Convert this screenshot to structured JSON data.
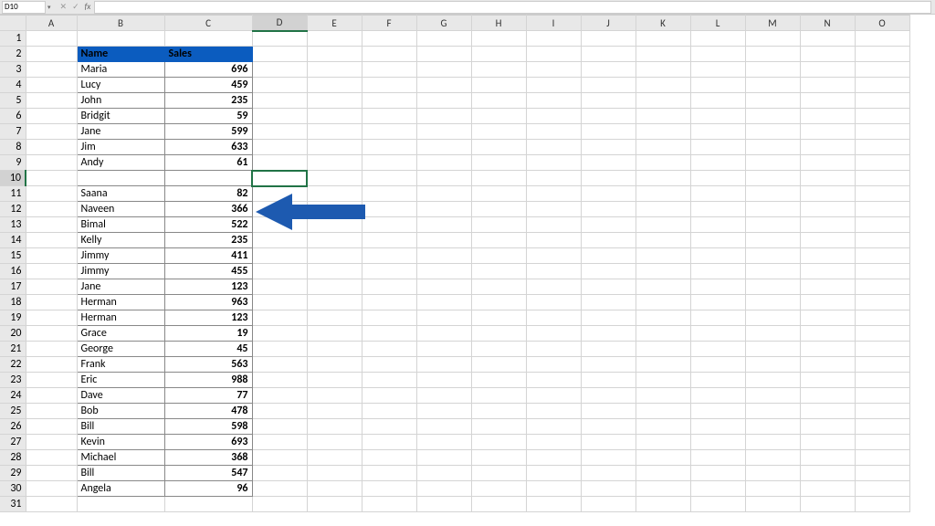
{
  "namebox": "D10",
  "fx": {
    "cancel": "✕",
    "accept": "✓",
    "fx": "fx"
  },
  "columns": [
    "A",
    "B",
    "C",
    "D",
    "E",
    "F",
    "G",
    "H",
    "I",
    "J",
    "K",
    "L",
    "M",
    "N",
    "O"
  ],
  "selectedCol": "D",
  "selectedRow": 10,
  "headerRow": 2,
  "tableHeaders": {
    "name": "Name",
    "sales": "Sales"
  },
  "rows": [
    {
      "r": 3,
      "name": "Maria",
      "sales": 696
    },
    {
      "r": 4,
      "name": "Lucy",
      "sales": 459
    },
    {
      "r": 5,
      "name": "John",
      "sales": 235
    },
    {
      "r": 6,
      "name": "Bridgit",
      "sales": 59
    },
    {
      "r": 7,
      "name": "Jane",
      "sales": 599
    },
    {
      "r": 8,
      "name": "Jim",
      "sales": 633
    },
    {
      "r": 9,
      "name": "Andy",
      "sales": 61
    },
    {
      "r": 10,
      "name": "",
      "sales": ""
    },
    {
      "r": 11,
      "name": "Saana",
      "sales": 82
    },
    {
      "r": 12,
      "name": "Naveen",
      "sales": 366
    },
    {
      "r": 13,
      "name": "Bimal",
      "sales": 522
    },
    {
      "r": 14,
      "name": "Kelly",
      "sales": 235
    },
    {
      "r": 15,
      "name": "Jimmy",
      "sales": 411
    },
    {
      "r": 16,
      "name": "Jimmy",
      "sales": 455
    },
    {
      "r": 17,
      "name": "Jane",
      "sales": 123
    },
    {
      "r": 18,
      "name": "Herman",
      "sales": 963
    },
    {
      "r": 19,
      "name": "Herman",
      "sales": 123
    },
    {
      "r": 20,
      "name": "Grace",
      "sales": 19
    },
    {
      "r": 21,
      "name": "George",
      "sales": 45
    },
    {
      "r": 22,
      "name": "Frank",
      "sales": 563
    },
    {
      "r": 23,
      "name": "Eric",
      "sales": 988
    },
    {
      "r": 24,
      "name": "Dave",
      "sales": 77
    },
    {
      "r": 25,
      "name": "Bob",
      "sales": 478
    },
    {
      "r": 26,
      "name": "Bill",
      "sales": 598
    },
    {
      "r": 27,
      "name": "Kevin",
      "sales": 693
    },
    {
      "r": 28,
      "name": "Michael",
      "sales": 368
    },
    {
      "r": 29,
      "name": "Bill",
      "sales": 547
    },
    {
      "r": 30,
      "name": "Angela",
      "sales": 96
    }
  ],
  "arrow": {
    "color": "#1d5ab0"
  }
}
